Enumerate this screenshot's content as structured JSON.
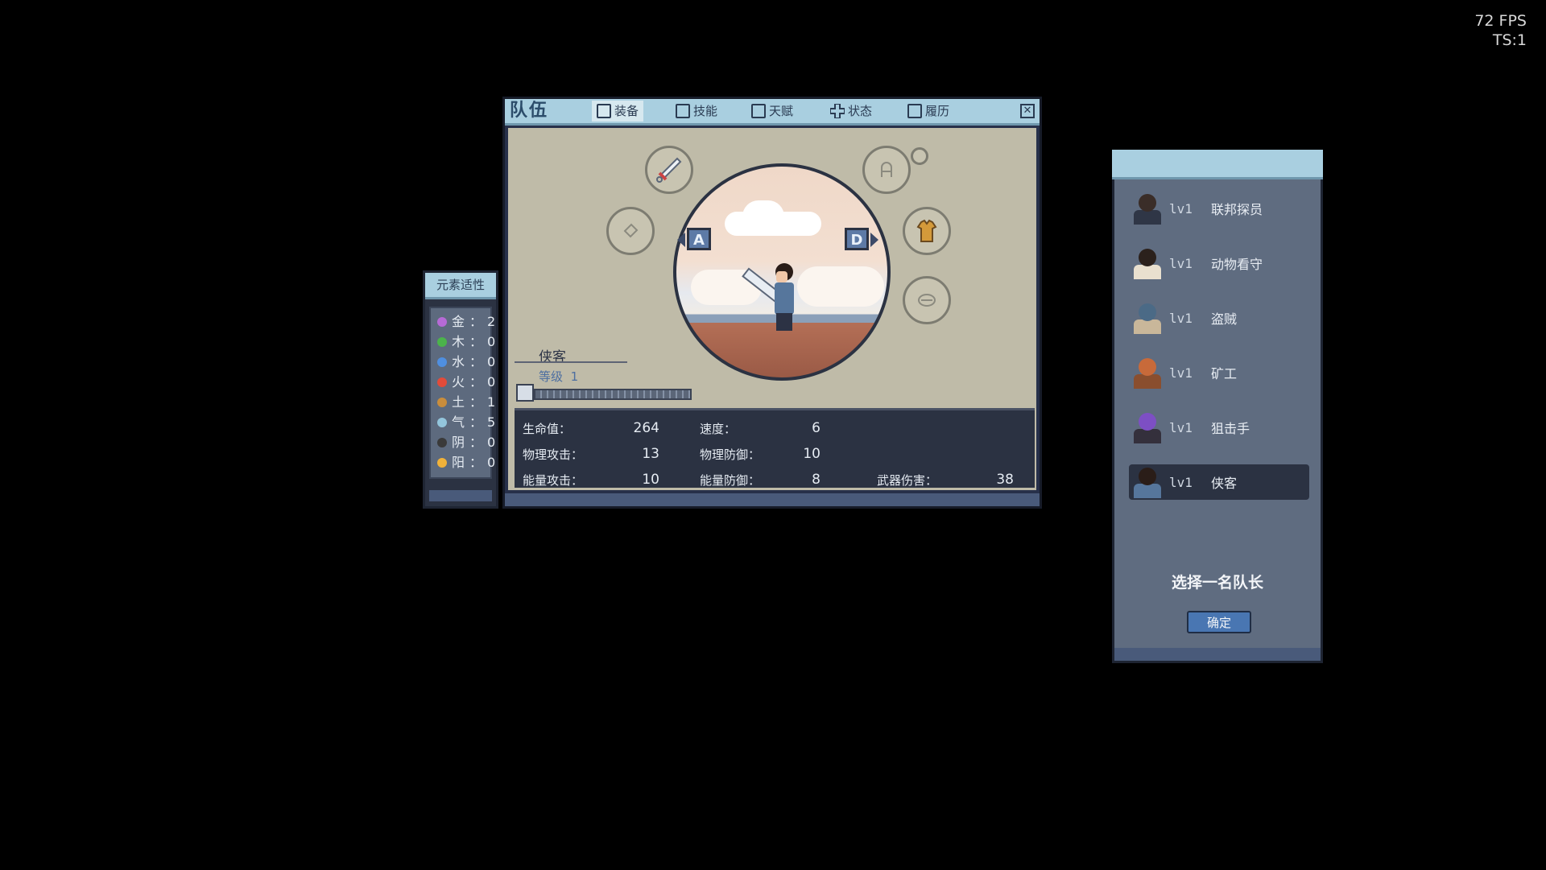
{
  "hud": {
    "fps": "72 FPS",
    "ts": "TS:1"
  },
  "elements": {
    "title": "元素适性",
    "rows": [
      {
        "name": "金",
        "value": "2",
        "color": "#b66ad6"
      },
      {
        "name": "木",
        "value": "0",
        "color": "#4bb34b"
      },
      {
        "name": "水",
        "value": "0",
        "color": "#4f8fe0"
      },
      {
        "name": "火",
        "value": "0",
        "color": "#e24b3a"
      },
      {
        "name": "土",
        "value": "1",
        "color": "#c98d3c"
      },
      {
        "name": "气",
        "value": "5",
        "color": "#93c5dc"
      },
      {
        "name": "阴",
        "value": "0",
        "color": "#3a3a3a"
      },
      {
        "name": "阳",
        "value": "0",
        "color": "#f1b23a"
      }
    ]
  },
  "party": {
    "title": "队伍",
    "tabs": [
      {
        "label": "装备",
        "icon": "equipment-icon",
        "active": true
      },
      {
        "label": "技能",
        "icon": "skill-icon"
      },
      {
        "label": "天赋",
        "icon": "talent-icon"
      },
      {
        "label": "状态",
        "icon": "status-icon"
      },
      {
        "label": "履历",
        "icon": "history-icon"
      }
    ],
    "character": {
      "name": "侠客",
      "level_label": "等级",
      "level": "1"
    },
    "nav": {
      "prev": "A",
      "next": "D"
    },
    "stats": {
      "hp": {
        "label": "生命值：",
        "value": "264"
      },
      "speed": {
        "label": "速度：",
        "value": "6"
      },
      "phys_atk": {
        "label": "物理攻击：",
        "value": "13"
      },
      "phys_def": {
        "label": "物理防御：",
        "value": "10"
      },
      "energy_atk": {
        "label": "能量攻击：",
        "value": "10"
      },
      "energy_def": {
        "label": "能量防御：",
        "value": "8"
      },
      "weapon_dmg": {
        "label": "武器伤害：",
        "value": "38"
      }
    }
  },
  "leader": {
    "members": [
      {
        "lv": "lv1",
        "name": "联邦探员",
        "hair": "#3a2d28",
        "coat": "#2f3646"
      },
      {
        "lv": "lv1",
        "name": "动物看守",
        "hair": "#2b211c",
        "coat": "#e9e0cf"
      },
      {
        "lv": "lv1",
        "name": "盗贼",
        "hair": "#4b6a86",
        "coat": "#c9b79a"
      },
      {
        "lv": "lv1",
        "name": "矿工",
        "hair": "#c86a3a",
        "coat": "#8a4e2e"
      },
      {
        "lv": "lv1",
        "name": "狙击手",
        "hair": "#7d4fc4",
        "coat": "#34303c"
      },
      {
        "lv": "lv1",
        "name": "侠客",
        "hair": "#2a1d18",
        "coat": "#56769c",
        "selected": true
      }
    ],
    "prompt": "选择一名队长",
    "confirm": "确定"
  }
}
